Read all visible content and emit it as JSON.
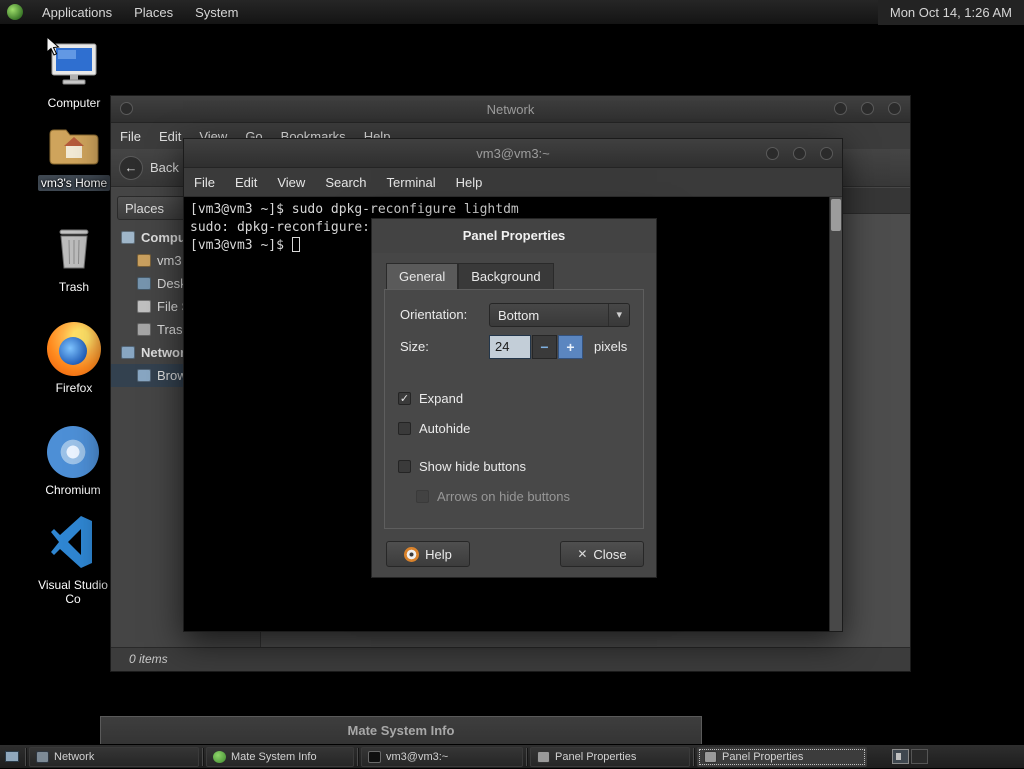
{
  "icons": {
    "dropdown_arrow": "▾",
    "back_arrow": "←",
    "minus": "−",
    "plus": "+",
    "close_x": "✕",
    "check": "✓"
  },
  "top_panel": {
    "menus": [
      "Applications",
      "Places",
      "System"
    ],
    "clock": "Mon Oct 14, 1:26 AM"
  },
  "desktop_icons": [
    {
      "label": "Computer"
    },
    {
      "label": "vm3's Home"
    },
    {
      "label": "Trash"
    },
    {
      "label": "Firefox"
    },
    {
      "label": "Chromium"
    },
    {
      "label": "Visual Studio Co"
    }
  ],
  "network_window": {
    "title": "Network",
    "menu": [
      "File",
      "Edit",
      "View",
      "Go",
      "Bookmarks",
      "Help"
    ],
    "back_label": "Back",
    "places_label": "Places",
    "tree": [
      {
        "label": "Computer"
      },
      {
        "label": "vm3"
      },
      {
        "label": "Desktop"
      },
      {
        "label": "File System"
      },
      {
        "label": "Trash"
      },
      {
        "label": "Network"
      },
      {
        "label": "Browse Network"
      }
    ],
    "status": "0 items"
  },
  "terminal": {
    "title": "vm3@vm3:~",
    "menu": [
      "File",
      "Edit",
      "View",
      "Search",
      "Terminal",
      "Help"
    ],
    "lines": [
      "[vm3@vm3 ~]$ sudo dpkg-reconfigure lightdm",
      "sudo: dpkg-reconfigure:",
      "[vm3@vm3 ~]$ "
    ]
  },
  "panel_properties": {
    "title": "Panel Properties",
    "tabs": [
      "General",
      "Background"
    ],
    "orientation_label": "Orientation:",
    "orientation_value": "Bottom",
    "size_label": "Size:",
    "size_value": "24",
    "size_unit": "pixels",
    "checks": [
      {
        "label": "Expand",
        "glyph": "✓"
      },
      {
        "label": "Autohide",
        "glyph": ""
      },
      {
        "label": "Show hide buttons",
        "glyph": ""
      },
      {
        "label": "Arrows on hide buttons",
        "glyph": ""
      }
    ],
    "help_label": "Help",
    "close_label": "Close"
  },
  "sysinfo": {
    "title": "Mate System Info"
  },
  "taskbar": {
    "items": [
      {
        "label": "Network"
      },
      {
        "label": "Mate System Info"
      },
      {
        "label": "vm3@vm3:~"
      },
      {
        "label": "Panel Properties"
      },
      {
        "label": "Panel Properties"
      }
    ]
  }
}
